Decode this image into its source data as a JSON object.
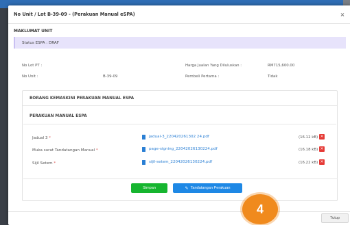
{
  "modal": {
    "title": "No Unit / Lot B-39-09 - (Perakuan Manual eSPA)",
    "close_glyph": "×"
  },
  "maklumat": {
    "heading": "MAKLUMAT UNIT",
    "status_text": "Status ESPA : DRAF",
    "fields": [
      {
        "label": "No Lot PT :",
        "value": ""
      },
      {
        "label": "No Unit :",
        "value": "B-39-09"
      },
      {
        "label": "Harga Jualan Yang Diluluskan :",
        "value": "RM715,600.00"
      },
      {
        "label": "Pembeli Pertama :",
        "value": "Tidak"
      }
    ]
  },
  "borang": {
    "heading": "BORANG KEMASKINI PERAKUAN MANUAL ESPA",
    "subheading": "PERAKUAN MANUAL ESPA",
    "required_mark": "*",
    "files": [
      {
        "label": "Jadual 3",
        "filename": "jadual-3_220420261302 24.pdf",
        "size": "(16.12 kB)"
      },
      {
        "label": "Muka surat Tandatangan Manual",
        "filename": "page-signing_22042026130224.pdf",
        "size": "(16.18 kB)"
      },
      {
        "label": "Sijil Setem",
        "filename": "sijil-setem_22042026130224.pdf",
        "size": "(16.22 kB)"
      }
    ],
    "delete_glyph": "×"
  },
  "actions": {
    "save_label": "Simpan",
    "sign_label": "Tandatangan Perakuan",
    "close_label": "Tutup"
  },
  "step_badge": "4",
  "colors": {
    "status_bg": "#e7e3fb",
    "save": "#16b52f",
    "sign": "#1e88e5",
    "delete": "#e53935",
    "badge": "#f08a1d",
    "link": "#2a7fd4"
  },
  "icons": {
    "file": "document-icon",
    "pen": "pencil-icon",
    "delete": "delete-icon",
    "close": "close-icon"
  }
}
